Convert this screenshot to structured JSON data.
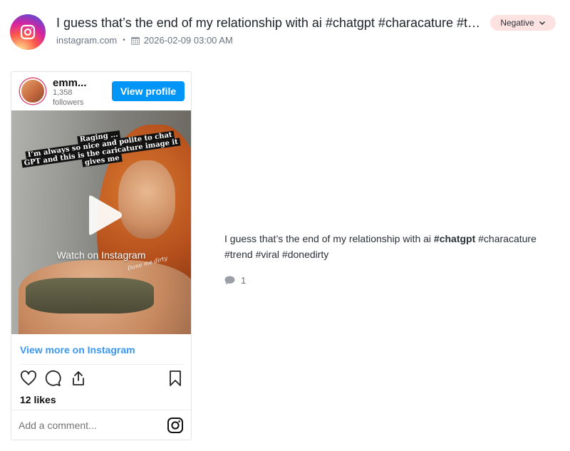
{
  "header": {
    "title": "I guess that’s the end of my relationship with ai #chatgpt #characature #tre...",
    "source": "instagram.com",
    "separator": "•",
    "timestamp": "2026-02-09 03:00 AM",
    "sentiment": "Negative",
    "source_icon": "instagram-icon",
    "colors": {
      "sentiment_bg": "#fde2e2",
      "brand_blue": "#0095f6",
      "link_blue": "#3897f0"
    }
  },
  "embed": {
    "username": "emm...",
    "followers": "1,358 followers",
    "view_profile_label": "View profile",
    "media": {
      "caption_line_1": "Raging ...",
      "caption_line_2": "I’m always so nice and polite to chat",
      "caption_line_3": "GPT and this is the caricature image it",
      "caption_line_4": "gives me",
      "doodle_text": "Done me dirty",
      "watch_label": "Watch on Instagram"
    },
    "view_more_label": "View more on Instagram",
    "actions": [
      "heart-icon",
      "comment-icon",
      "share-icon",
      "bookmark-icon"
    ],
    "likes": "12 likes",
    "comment_placeholder": "Add a comment..."
  },
  "post": {
    "text_before": "I guess that’s the end of my relationship with ai ",
    "bold_tag": "#chatgpt",
    "text_after": " #characature #trend #viral #donedirty",
    "comment_count": "1"
  }
}
